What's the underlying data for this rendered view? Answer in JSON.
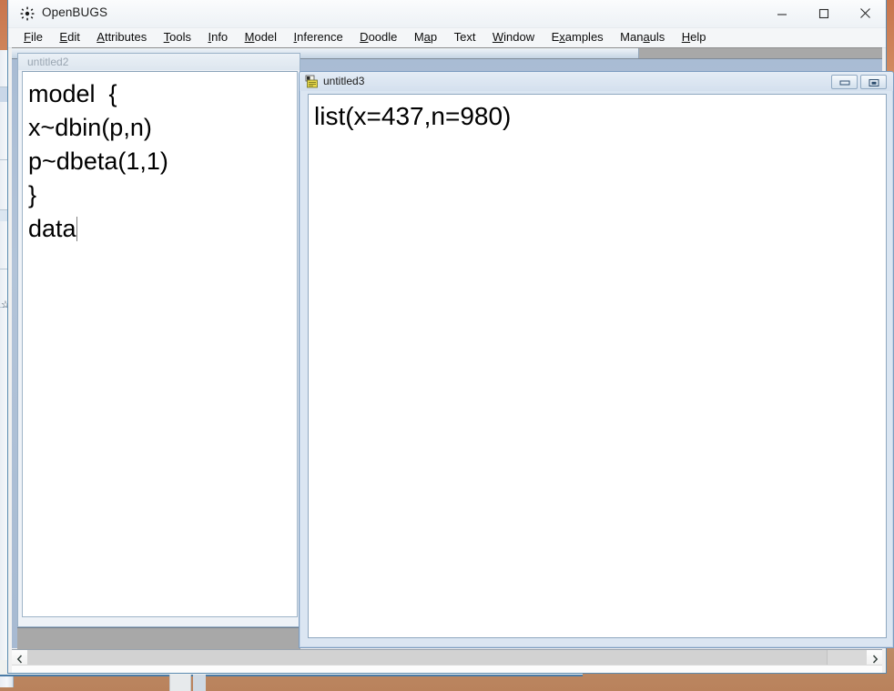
{
  "app": {
    "title": "OpenBUGS",
    "icon": "openbugs-sunburst-icon"
  },
  "window_controls": {
    "minimize_label": "Minimize",
    "maximize_label": "Maximize",
    "close_label": "Close"
  },
  "menu": {
    "items": [
      {
        "label": "File",
        "accel": "F"
      },
      {
        "label": "Edit",
        "accel": "E"
      },
      {
        "label": "Attributes",
        "accel": "A"
      },
      {
        "label": "Tools",
        "accel": "T"
      },
      {
        "label": "Info",
        "accel": "I"
      },
      {
        "label": "Model",
        "accel": "M"
      },
      {
        "label": "Inference",
        "accel": "I"
      },
      {
        "label": "Doodle",
        "accel": "D"
      },
      {
        "label": "Map",
        "accel": "a"
      },
      {
        "label": "Text",
        "accel": ""
      },
      {
        "label": "Window",
        "accel": "W"
      },
      {
        "label": "Examples",
        "accel": "x"
      },
      {
        "label": "Manuals",
        "accel": "a"
      },
      {
        "label": "Help",
        "accel": "H"
      }
    ]
  },
  "documents": {
    "untitled2": {
      "title": "untitled2",
      "active": false,
      "code": "model  {\nx~dbin(p,n)\np~dbeta(1,1)\n}\ndata"
    },
    "untitled3": {
      "title": "untitled3",
      "active": true,
      "icon": "document-icon",
      "code": "list(x=437,n=980)",
      "buttons": {
        "minimize_label": "Minimize",
        "restore_label": "Restore"
      }
    }
  },
  "scrollbars": {
    "bottom_left_arrow": "‹",
    "bottom_right_arrow": "›"
  }
}
